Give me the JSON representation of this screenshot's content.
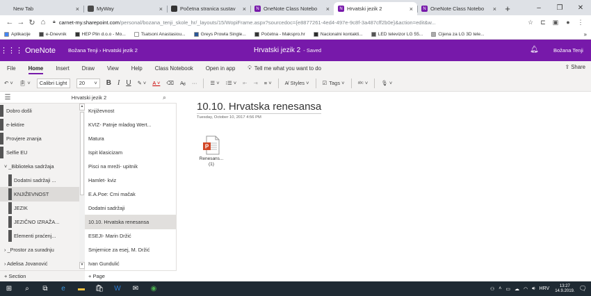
{
  "browser": {
    "tabs": [
      {
        "title": "New Tab",
        "icon": "blank-tab-icon",
        "color": "#dee1e6",
        "active": false
      },
      {
        "title": "MyWay",
        "icon": "myway-icon",
        "color": "#4a4a4a",
        "active": false
      },
      {
        "title": "Početna stranica sustav",
        "icon": "page-icon",
        "color": "#333333",
        "active": false
      },
      {
        "title": "OneNote Class Notebo",
        "icon": "onenote-icon",
        "color": "#7719aa",
        "active": false
      },
      {
        "title": "Hrvatski jezik 2",
        "icon": "onenote-icon",
        "color": "#7719aa",
        "active": true
      },
      {
        "title": "OneNote Class Notebo",
        "icon": "onenote-icon",
        "color": "#7719aa",
        "active": false
      }
    ],
    "new_tab": "+",
    "window_controls": {
      "minimize": "–",
      "maximize": "❐",
      "close": "✕"
    },
    "address": {
      "host": "carnet-my.sharepoint.com",
      "path": "/personal/bozana_tenji_skole_hr/_layouts/15/WopiFrame.aspx?sourcedoc={e8877261-4ed4-497e-9c8f-3a487cff2b0e}&action=edit&w..."
    },
    "bookmarks": [
      {
        "label": "Aplikacije",
        "color": "#4285f4"
      },
      {
        "label": "e-Dnevnik",
        "color": "#444444"
      },
      {
        "label": "HEP Plin d.o.o - Mo...",
        "color": "#333333"
      },
      {
        "label": "Tsatsoni Anastasiou...",
        "color": "#ffffff"
      },
      {
        "label": "Greys Prowla Single...",
        "color": "#2b5797"
      },
      {
        "label": "Početna - Makspro.hr",
        "color": "#333333"
      },
      {
        "label": "Nacionalni kontakti...",
        "color": "#2b2b2b"
      },
      {
        "label": "LED televizor LG 55...",
        "color": "#555555"
      },
      {
        "label": "Cijena za LG 3D tele...",
        "color": "#aaaaaa"
      }
    ],
    "bookmarks_more": "»"
  },
  "onenote": {
    "app_name": "OneNote",
    "breadcrumb": "Božana Tenji  ›  Hrvatski jezik 2",
    "doc_title": "Hrvatski jezik 2",
    "doc_status": "-  Saved",
    "user_name": "Božana Tenji",
    "ribbon_tabs": [
      "File",
      "Home",
      "Insert",
      "Draw",
      "View",
      "Help",
      "Class Notebook",
      "Open in app"
    ],
    "selected_tab": "Home",
    "tell_me": "Tell me what you want to do",
    "share": "Share",
    "font_name": "Calibri Light",
    "font_size": "20",
    "styles_label": "Styles",
    "tags_label": "Tags",
    "accent": "#7719aa"
  },
  "nav": {
    "notebook_name": "Hrvatski jezik 2",
    "sections": [
      {
        "label": "Dobro došli",
        "bar": true,
        "bar_color": "#555555",
        "indent": false,
        "selected": false
      },
      {
        "label": "e-lektire",
        "bar": true,
        "bar_color": "#555555",
        "indent": false,
        "selected": false
      },
      {
        "label": "Provjere znanja",
        "bar": true,
        "bar_color": "#555555",
        "indent": false,
        "selected": false
      },
      {
        "label": "Selfie EU",
        "bar": true,
        "bar_color": "#555555",
        "indent": false,
        "selected": false
      },
      {
        "label": "˅ _Biblioteka sadržaja",
        "bar": false,
        "indent": false,
        "selected": false
      },
      {
        "label": "Dodatni sadržaji ...",
        "bar": true,
        "bar_color": "#555555",
        "indent": true,
        "selected": false
      },
      {
        "label": "KNJIŽEVNOST",
        "bar": true,
        "bar_color": "#555555",
        "indent": true,
        "selected": true
      },
      {
        "label": "JEZIK",
        "bar": true,
        "bar_color": "#555555",
        "indent": true,
        "selected": false
      },
      {
        "label": "JEZIČNO IZRAŽA...",
        "bar": true,
        "bar_color": "#555555",
        "indent": true,
        "selected": false
      },
      {
        "label": "Elementi praćenj...",
        "bar": true,
        "bar_color": "#555555",
        "indent": true,
        "selected": false
      },
      {
        "label": "› _Prostor za suradnju",
        "bar": false,
        "indent": false,
        "selected": false
      },
      {
        "label": "› Adelisa Jovanović",
        "bar": false,
        "indent": false,
        "selected": false
      }
    ],
    "pages": [
      {
        "label": "Književnost",
        "selected": false
      },
      {
        "label": "KVIZ- Patnje mladog Wert...",
        "selected": false
      },
      {
        "label": "Matura",
        "selected": false
      },
      {
        "label": "Ispit klasicizam",
        "selected": false
      },
      {
        "label": "Pisci na mreži- upitnik",
        "selected": false
      },
      {
        "label": "Hamlet- kviz",
        "selected": false
      },
      {
        "label": "E.A.Poe: Crni mačak",
        "selected": false
      },
      {
        "label": "Dodatni sadržaji",
        "selected": false
      },
      {
        "label": "10.10. Hrvatska renesansa",
        "selected": true
      },
      {
        "label": "ESEJI- Marin Držić",
        "selected": false
      },
      {
        "label": "Smjernice za esej, M. Držić",
        "selected": false
      },
      {
        "label": "Ivan Gundulić",
        "selected": false
      }
    ],
    "add_section": "+ Section",
    "add_page": "+ Page"
  },
  "page": {
    "title": "10.10. Hrvatska renesansa",
    "date": "Tuesday, October 10, 2017     4:56 PM",
    "attachment_name_line1": "Renesans...",
    "attachment_name_line2": "(1)"
  },
  "taskbar": {
    "clock_time": "13:27",
    "clock_date": "14.9.2019.",
    "language": "HRV"
  }
}
